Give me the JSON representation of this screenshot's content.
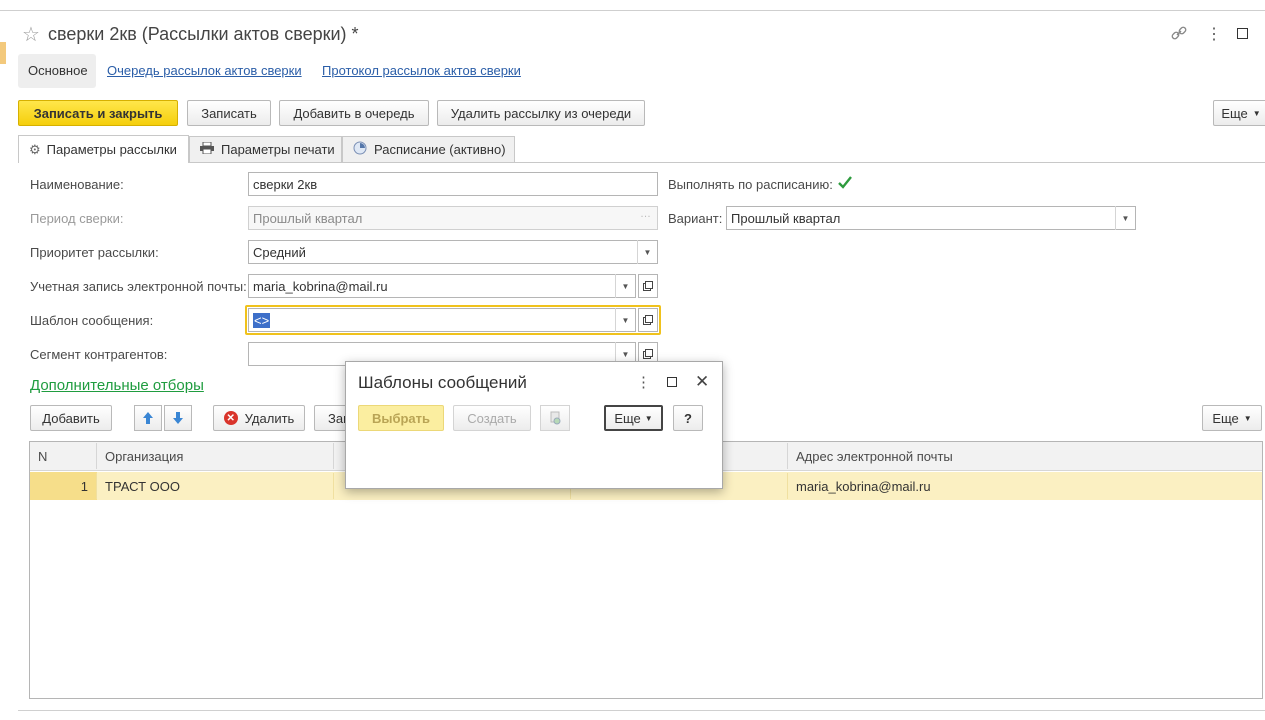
{
  "window": {
    "title": "сверки 2кв (Рассылки актов сверки) *",
    "nav_links": [
      "Основное",
      "Очередь рассылок актов сверки",
      "Протокол рассылок актов сверки"
    ]
  },
  "toolbar": {
    "save_close": "Записать и закрыть",
    "save": "Записать",
    "add_queue": "Добавить в очередь",
    "remove_queue": "Удалить рассылку из очереди",
    "more": "Еще"
  },
  "tabs": [
    "Параметры рассылки",
    "Параметры печати",
    "Расписание (активно)"
  ],
  "form": {
    "name_label": "Наименование:",
    "name_value": "сверки 2кв",
    "period_label": "Период сверки:",
    "period_value": "Прошлый квартал",
    "priority_label": "Приоритет рассылки:",
    "priority_value": "Средний",
    "email_label": "Учетная запись электронной почты:",
    "email_value": "maria_kobrina@mail.ru",
    "template_label": "Шаблон сообщения:",
    "template_value": "<>",
    "segment_label": "Сегмент контрагентов:",
    "segment_value": "",
    "schedule_label": "Выполнять по расписанию:",
    "schedule_checked": true,
    "variant_label": "Вариант:",
    "variant_value": "Прошлый квартал"
  },
  "filters": {
    "title": "Дополнительные отборы",
    "add": "Добавить",
    "delete": "Удалить",
    "fill_partial": "Зап",
    "more": "Еще"
  },
  "table": {
    "columns": [
      "N",
      "Организация",
      "",
      "",
      "Адрес электронной почты"
    ],
    "rows": [
      {
        "n": "1",
        "org": "ТРАСТ ООО",
        "col3": "",
        "col4": "",
        "email": "maria_kobrina@mail.ru"
      }
    ]
  },
  "dialog": {
    "title": "Шаблоны сообщений",
    "select": "Выбрать",
    "create": "Создать",
    "more": "Еще",
    "help": "?"
  },
  "colors": {
    "accent_yellow": "#f5cf0c",
    "selected_row": "#fbf0c2",
    "link_blue": "#2b5ea8",
    "green_link": "#1f9c3f"
  }
}
